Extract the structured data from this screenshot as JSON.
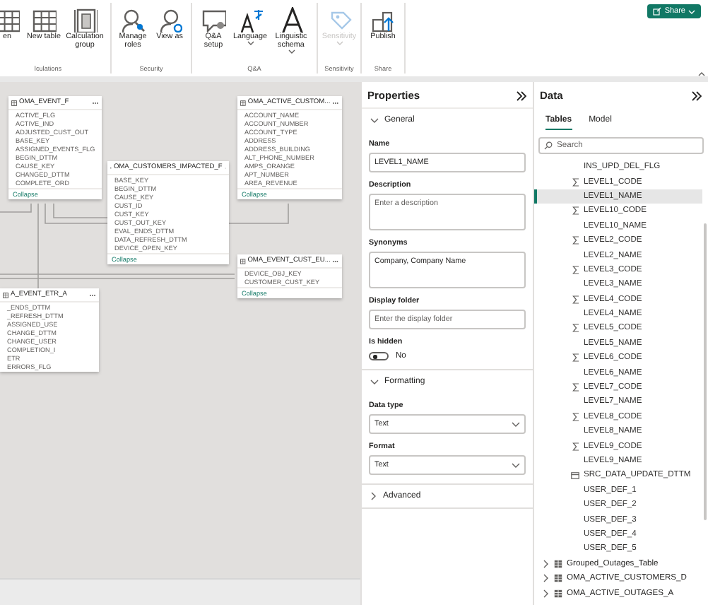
{
  "ribbon": {
    "groups": [
      {
        "label": "lculations",
        "buttons": [
          {
            "label": "en",
            "kind": "table"
          },
          {
            "label": "New table",
            "kind": "table"
          },
          {
            "label": "Calculation group",
            "kind": "calc-group"
          }
        ]
      },
      {
        "label": "Security",
        "buttons": [
          {
            "label": "Manage roles",
            "kind": "roles"
          },
          {
            "label": "View as",
            "kind": "view-as"
          }
        ]
      },
      {
        "label": "Q&A",
        "buttons": [
          {
            "label": "Q&A setup",
            "kind": "qa"
          },
          {
            "label": "Language",
            "kind": "language",
            "dropdown": true
          },
          {
            "label": "Linguistic schema",
            "kind": "linguistic",
            "dropdown": true
          }
        ]
      },
      {
        "label": "Sensitivity",
        "buttons": [
          {
            "label": "Sensitivity",
            "kind": "sensitivity",
            "dropdown": true,
            "disabled": true
          }
        ]
      },
      {
        "label": "Share",
        "buttons": [
          {
            "label": "Publish",
            "kind": "publish"
          }
        ]
      }
    ],
    "share_button": "Share"
  },
  "diagram": {
    "tables": [
      {
        "title": "OMA_EVENT_F",
        "fields": [
          "ACTIVE_FLG",
          "ACTIVE_IND",
          "ADJUSTED_CUST_OUT",
          "BASE_KEY",
          "ASSIGNED_EVENTS_FLG",
          "BEGIN_DTTM",
          "CAUSE_KEY",
          "CHANGED_DTTM",
          "COMPLETE_ORD"
        ],
        "collapse": "Collapse"
      },
      {
        "title": "OMA_ACTIVE_CUSTOM...",
        "fields": [
          "ACCOUNT_NAME",
          "ACCOUNT_NUMBER",
          "ACCOUNT_TYPE",
          "ADDRESS",
          "ADDRESS_BUILDING",
          "ALT_PHONE_NUMBER",
          "AMPS_ORANGE",
          "APT_NUMBER",
          "AREA_REVENUE"
        ],
        "collapse": "Collapse"
      },
      {
        "title": "OMA_CUSTOMERS_IMPACTED_F",
        "fields": [
          "BASE_KEY",
          "BEGIN_DTTM",
          "CAUSE_KEY",
          "CUST_ID",
          "CUST_KEY",
          "CUST_OUT_KEY",
          "EVAL_ENDS_DTTM",
          "DATA_REFRESH_DTTM",
          "DEVICE_OPEN_KEY"
        ],
        "collapse": "Collapse"
      },
      {
        "title": "OMA_EVENT_CUST_EU...",
        "fields": [
          "DEVICE_OBJ_KEY",
          "CUSTOMER_CUST_KEY"
        ],
        "collapse": "Collapse"
      },
      {
        "title": "A_EVENT_ETR_A",
        "fields": [
          "_ENDS_DTTM",
          "_REFRESH_DTTM",
          "ASSIGNED_USE",
          "CHANGE_DTTM",
          "CHANGE_USER",
          "COMPLETION_I",
          "ETR",
          "ERRORS_FLG"
        ]
      }
    ]
  },
  "properties": {
    "title": "Properties",
    "sections": [
      {
        "title": "General",
        "expanded": true,
        "fields": [
          {
            "kind": "text",
            "label": "Name",
            "value": "LEVEL1_NAME"
          },
          {
            "kind": "textarea",
            "label": "Description",
            "placeholder": "Enter a description"
          },
          {
            "kind": "textarea",
            "label": "Synonyms",
            "value": "Company, Company Name"
          },
          {
            "kind": "text",
            "label": "Display folder",
            "placeholder": "Enter the display folder"
          },
          {
            "kind": "toggle",
            "label": "Is hidden",
            "on": false,
            "state_text": "No"
          }
        ]
      },
      {
        "title": "Formatting",
        "expanded": true,
        "fields": [
          {
            "kind": "select",
            "label": "Data type",
            "value": "Text"
          },
          {
            "kind": "select",
            "label": "Format",
            "value": "Text"
          }
        ]
      },
      {
        "title": "Advanced",
        "expanded": false
      }
    ]
  },
  "data_pane": {
    "title": "Data",
    "tabs": [
      {
        "label": "Tables",
        "selected": true
      },
      {
        "label": "Model",
        "selected": false
      }
    ],
    "search": {
      "placeholder": "Search"
    },
    "fields": [
      {
        "name": "INS_UPD_DEL_FLG",
        "kind": "text",
        "selected": false
      },
      {
        "name": "LEVEL1_CODE",
        "kind": "number",
        "selected": false
      },
      {
        "name": "LEVEL1_NAME",
        "kind": "text",
        "selected": true
      },
      {
        "name": "LEVEL10_CODE",
        "kind": "number",
        "selected": false
      },
      {
        "name": "LEVEL10_NAME",
        "kind": "text",
        "selected": false
      },
      {
        "name": "LEVEL2_CODE",
        "kind": "number",
        "selected": false
      },
      {
        "name": "LEVEL2_NAME",
        "kind": "text",
        "selected": false
      },
      {
        "name": "LEVEL3_CODE",
        "kind": "number",
        "selected": false
      },
      {
        "name": "LEVEL3_NAME",
        "kind": "text",
        "selected": false
      },
      {
        "name": "LEVEL4_CODE",
        "kind": "number",
        "selected": false
      },
      {
        "name": "LEVEL4_NAME",
        "kind": "text",
        "selected": false
      },
      {
        "name": "LEVEL5_CODE",
        "kind": "number",
        "selected": false
      },
      {
        "name": "LEVEL5_NAME",
        "kind": "text",
        "selected": false
      },
      {
        "name": "LEVEL6_CODE",
        "kind": "number",
        "selected": false
      },
      {
        "name": "LEVEL6_NAME",
        "kind": "text",
        "selected": false
      },
      {
        "name": "LEVEL7_CODE",
        "kind": "number",
        "selected": false
      },
      {
        "name": "LEVEL7_NAME",
        "kind": "text",
        "selected": false
      },
      {
        "name": "LEVEL8_CODE",
        "kind": "number",
        "selected": false
      },
      {
        "name": "LEVEL8_NAME",
        "kind": "text",
        "selected": false
      },
      {
        "name": "LEVEL9_CODE",
        "kind": "number",
        "selected": false
      },
      {
        "name": "LEVEL9_NAME",
        "kind": "text",
        "selected": false
      },
      {
        "name": "SRC_DATA_UPDATE_DTTM",
        "kind": "datetime",
        "selected": false
      },
      {
        "name": "USER_DEF_1",
        "kind": "text",
        "selected": false
      },
      {
        "name": "USER_DEF_2",
        "kind": "text",
        "selected": false
      },
      {
        "name": "USER_DEF_3",
        "kind": "text",
        "selected": false
      },
      {
        "name": "USER_DEF_4",
        "kind": "text",
        "selected": false
      },
      {
        "name": "USER_DEF_5",
        "kind": "text",
        "selected": false
      }
    ],
    "tables": [
      {
        "name": "Grouped_Outages_Table",
        "expanded": false
      },
      {
        "name": "OMA_ACTIVE_CUSTOMERS_D",
        "expanded": false
      },
      {
        "name": "OMA_ACTIVE_OUTAGES_A",
        "expanded": false
      }
    ]
  }
}
